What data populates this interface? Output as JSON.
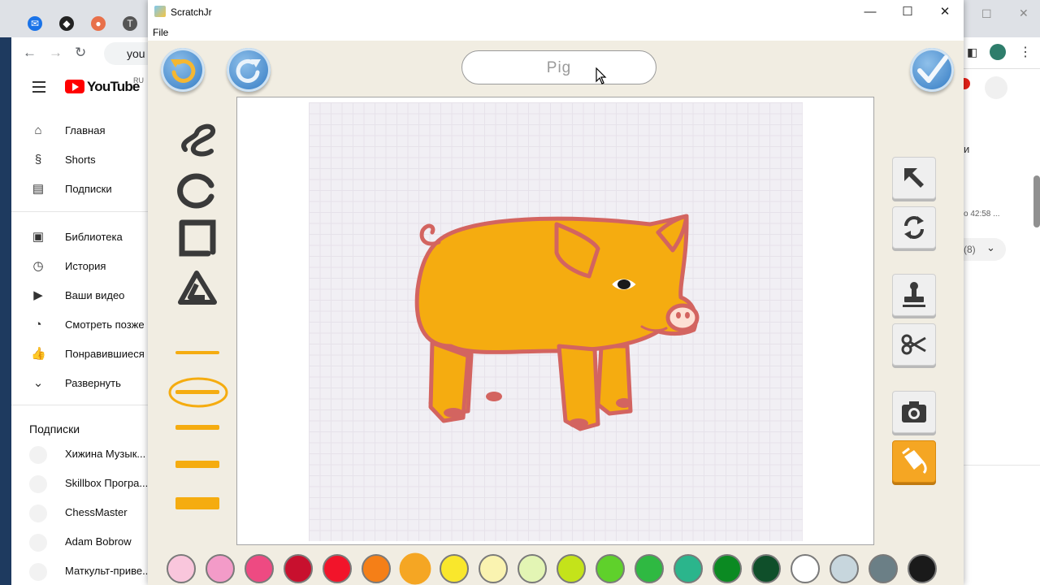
{
  "browser_left": {
    "omnibox_text": "you",
    "youtube": {
      "logo_text": "YouTube",
      "region": "RU",
      "nav": [
        {
          "label": "Главная",
          "icon": "home-icon"
        },
        {
          "label": "Shorts",
          "icon": "shorts-icon"
        },
        {
          "label": "Подписки",
          "icon": "subscriptions-icon"
        },
        {
          "label": "Библиотека",
          "icon": "library-icon"
        },
        {
          "label": "История",
          "icon": "history-icon"
        },
        {
          "label": "Ваши видео",
          "icon": "your-videos-icon"
        },
        {
          "label": "Смотреть позже",
          "icon": "watch-later-icon"
        },
        {
          "label": "Понравившиеся",
          "icon": "liked-icon"
        },
        {
          "label": "Развернуть",
          "icon": "chevron-down-icon"
        }
      ],
      "subscriptions_heading": "Подписки",
      "subscriptions": [
        "Хижина Музык...",
        "Skillbox Програ...",
        "ChessMaster",
        "Adam Bobrow",
        "Маткульт-приве..."
      ]
    }
  },
  "browser_right": {
    "time_text": "о 42:58 ...",
    "count_text": "(8)",
    "letter": "и"
  },
  "window": {
    "title": "ScratchJr",
    "menu": [
      "File"
    ],
    "minimize": "—",
    "maximize": "☐",
    "close": "✕"
  },
  "paint_editor": {
    "character_name": "Pig",
    "tools": [
      "freehand-line",
      "ellipse",
      "rectangle",
      "triangle"
    ],
    "line_widths": [
      "thin",
      "medium-selected",
      "medium",
      "thick",
      "thickest"
    ],
    "side_tools": [
      "select-arrow",
      "rotate",
      "stamp",
      "cut",
      "camera",
      "fill-bucket"
    ],
    "active_side_tool": "fill-bucket",
    "palette": [
      "#f9c6dc",
      "#f39bc8",
      "#ee4a82",
      "#c8102e",
      "#f2142a",
      "#f57f17",
      "#f5a623",
      "#f9e72c",
      "#faf3b0",
      "#e3f5b4",
      "#c4e31a",
      "#5fd12b",
      "#2fb942",
      "#2bb58c",
      "#0b8a22",
      "#0f4f2a",
      "#ffffff",
      "#c7d6dd",
      "#6b7f86",
      "#1a1a1a"
    ],
    "selected_color": "#f5a623",
    "sprite_colors": {
      "body": "#f5ac10",
      "outline": "#d36460",
      "eye": "#1a1a1a"
    }
  }
}
